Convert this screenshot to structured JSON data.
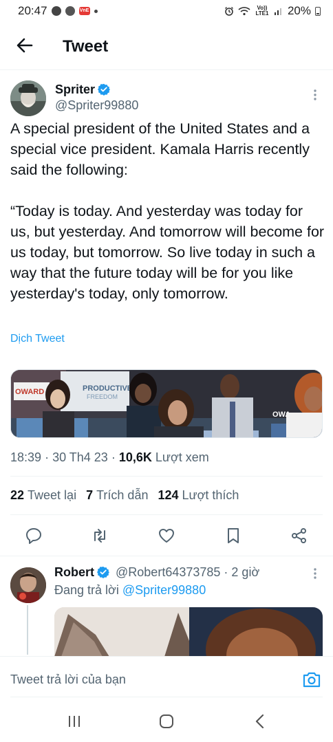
{
  "status_bar": {
    "time": "20:47",
    "network_label": "Vo)) LTE1",
    "battery": "20%"
  },
  "header": {
    "title": "Tweet"
  },
  "tweet": {
    "author_name": "Spriter",
    "author_handle": "@Spriter99880",
    "text": "A special president of the United States and a special vice president. Kamala Harris recently said the following:\n\n“Today is today. And yesterday was today for us, but yesterday. And tomorrow will become for us today, but tomorrow. So live today in such a way that the future today will be for you like yesterday's today, only tomorrow.",
    "translate_label": "Dịch Tweet",
    "media_signs": [
      "OWARD",
      "PRODUCTIVE",
      "FREEDOM",
      "OWA"
    ],
    "time": "18:39",
    "date": "30 Th4 23",
    "views_count": "10,6K",
    "views_label": "Lượt xem",
    "stats": [
      {
        "count": "22",
        "label": "Tweet lại"
      },
      {
        "count": "7",
        "label": "Trích dẫn"
      },
      {
        "count": "124",
        "label": "Lượt thích"
      }
    ]
  },
  "reply": {
    "author_name": "Robert",
    "author_handle": "@Robert64373785",
    "time_ago": "2 giờ",
    "replying_to_prefix": "Đang trả lời",
    "replying_to_handle": "@Spriter99880"
  },
  "compose": {
    "placeholder": "Tweet trả lời của bạn"
  },
  "colors": {
    "accent": "#1d9bf0",
    "text": "#0f1419",
    "secondary_text": "#536471",
    "divider": "#eff3f4"
  }
}
